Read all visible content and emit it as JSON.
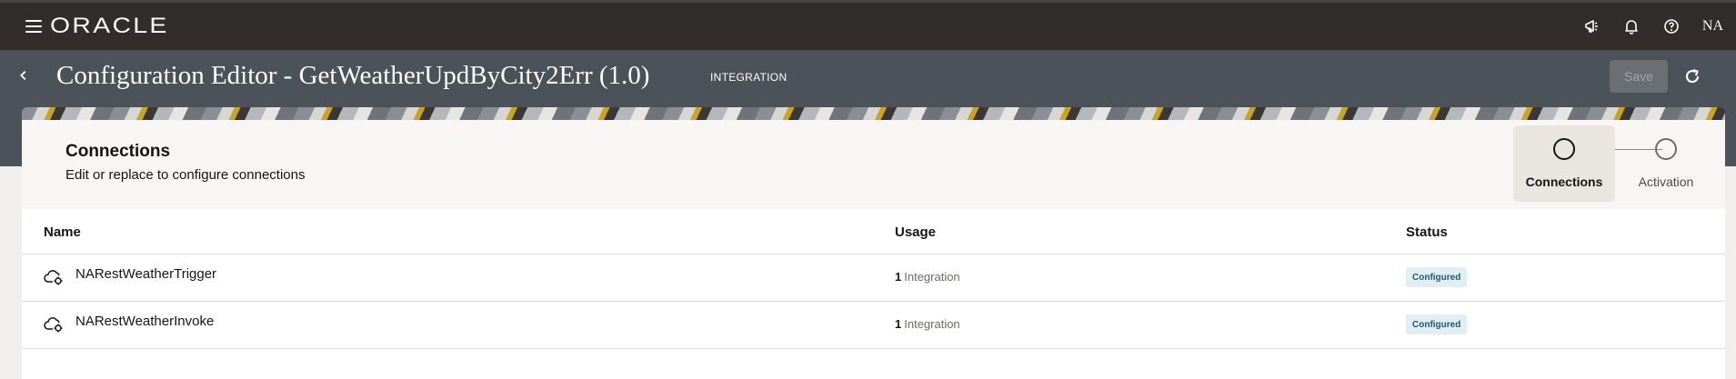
{
  "brand": {
    "logo": "ORACLE"
  },
  "header": {
    "icons": [
      "megaphone-icon",
      "bell-icon",
      "help-icon"
    ],
    "user_initials": "NA"
  },
  "titlebar": {
    "title": "Configuration Editor - GetWeatherUpdByCity2Err (1.0)",
    "badge": "INTEGRATION",
    "save_label": "Save"
  },
  "section": {
    "title": "Connections",
    "subtitle": "Edit or replace to configure connections"
  },
  "train": {
    "steps": [
      {
        "label": "Connections",
        "active": true
      },
      {
        "label": "Activation",
        "active": false
      }
    ]
  },
  "table": {
    "columns": [
      "Name",
      "Usage",
      "Status"
    ],
    "rows": [
      {
        "name": "NARestWeatherTrigger",
        "usage_count": "1",
        "usage_label": "Integration",
        "status": "Configured"
      },
      {
        "name": "NARestWeatherInvoke",
        "usage_count": "1",
        "usage_label": "Integration",
        "status": "Configured"
      }
    ]
  },
  "colors": {
    "topbar": "#312d2a",
    "titlebar": "#4c525a",
    "status_badge_bg": "#e1eff5",
    "status_badge_text": "#1c5a73"
  }
}
